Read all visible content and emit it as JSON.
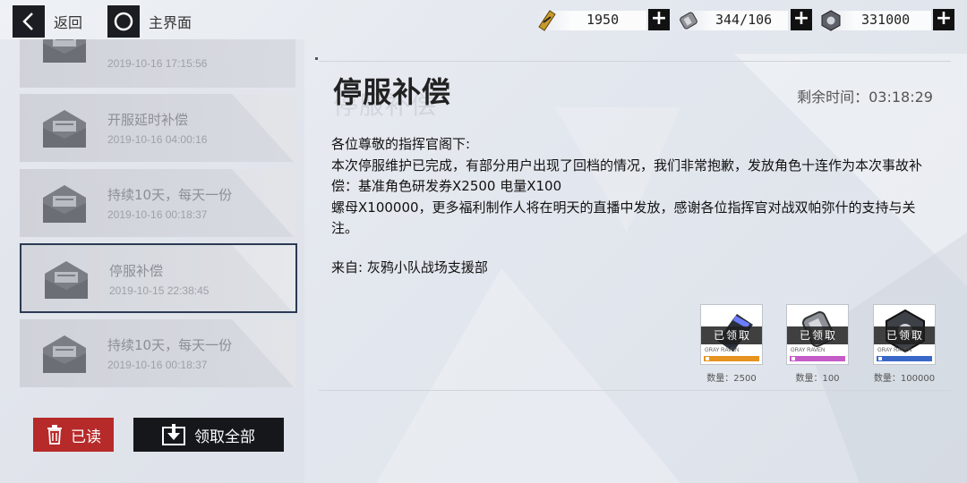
{
  "nav": {
    "back_label": "返回",
    "home_label": "主界面"
  },
  "resources": [
    {
      "icon": "gold-ticket-icon",
      "value": "1950"
    },
    {
      "icon": "battery-icon",
      "value": "344/106"
    },
    {
      "icon": "screw-nut-icon",
      "value": "331000"
    }
  ],
  "mail_list": [
    {
      "title": "",
      "time": "2019-10-16 17:15:56"
    },
    {
      "title": "开服延时补偿",
      "time": "2019-10-16 04:00:16"
    },
    {
      "title": "持续10天，每天一份",
      "time": "2019-10-16 00:18:37"
    },
    {
      "title": "停服补偿",
      "time": "2019-10-15 22:38:45"
    },
    {
      "title": "持续10天，每天一份",
      "time": "2019-10-16 00:18:37"
    }
  ],
  "buttons": {
    "read_label": "已读",
    "claim_all_label": "领取全部"
  },
  "detail": {
    "title": "停服补偿",
    "remaining": "剩余时间：03:18:29",
    "body": [
      "各位尊敬的指挥官阁下:",
      "本次停服维护已完成，有部分用户出现了回档的情况，我们非常抱歉，发放角色十连作为本次事故补偿：基准角色研发券X2500 电量X100",
      "螺母X100000，更多福利制作人将在明天的直播中发放，感谢各位指挥官对战双帕弥什的支持与关注。",
      "",
      "来自: 灰鸦小队战场支援部"
    ],
    "rewards": [
      {
        "icon": "research-ticket-icon",
        "status": "已领取",
        "brand": "GRAY RAVEN",
        "quantity": "数量：2500",
        "rarity_color": "#e7931f"
      },
      {
        "icon": "battery-icon",
        "status": "已领取",
        "brand": "GRAY RAVEN",
        "quantity": "数量：100",
        "rarity_color": "#c45bc7"
      },
      {
        "icon": "screw-nut-icon",
        "status": "已领取",
        "brand": "GRAY RAVEN",
        "quantity": "数量：100000",
        "rarity_color": "#3a68c8"
      }
    ]
  },
  "colors": {
    "read_button": "#b72a2a",
    "dark_button": "#15171b",
    "selected_border": "#2c3a52"
  }
}
